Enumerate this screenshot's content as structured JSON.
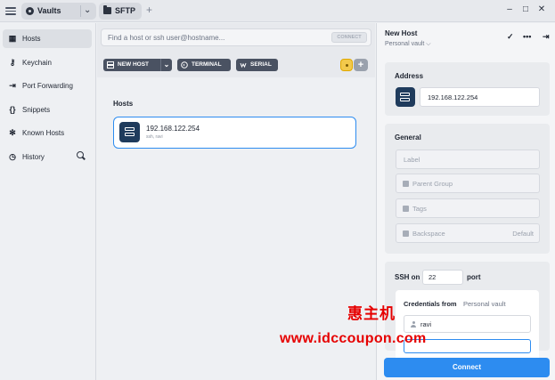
{
  "topbar": {
    "vault_label": "Vaults",
    "tab_label": "SFTP",
    "new_tab_symbol": "+",
    "window_buttons": [
      "–",
      "□",
      "✕"
    ]
  },
  "sidebar": {
    "items": [
      {
        "label": "Hosts",
        "icon": "hosts-icon",
        "active": true
      },
      {
        "label": "Keychain",
        "icon": "key-icon"
      },
      {
        "label": "Port Forwarding",
        "icon": "port-forwarding-icon"
      },
      {
        "label": "Snippets",
        "icon": "snippets-icon"
      },
      {
        "label": "Known Hosts",
        "icon": "known-hosts-icon"
      },
      {
        "label": "History",
        "icon": "history-icon"
      }
    ]
  },
  "main": {
    "quick_connect_placeholder": "Find a host or ssh user@hostname...",
    "connect_label": "CONNECT",
    "new_host_label": "NEW HOST",
    "terminal_label": "TERMINAL",
    "serial_label": "SERIAL",
    "section_title": "Hosts",
    "hosts": [
      {
        "name": "192.168.122.254",
        "sub": "ssh, ravi"
      }
    ]
  },
  "panel": {
    "title": "New Host",
    "subtitle": "Personal vault ⌵",
    "address_title": "Address",
    "address_value": "192.168.122.254",
    "general_title": "General",
    "label_placeholder": "Label",
    "parent_group_placeholder": "Parent Group",
    "tags_placeholder": "Tags",
    "backspace_label": "Backspace",
    "backspace_value": "Default",
    "ssh_on_label": "SSH on",
    "port_value": "22",
    "port_label": "port",
    "credentials_label": "Credentials from",
    "credentials_value": "Personal vault",
    "username_value": "ravi",
    "connect_button": "Connect"
  },
  "watermark": {
    "line1": "惠主机",
    "line2": "www.idccoupon.com"
  },
  "colors": {
    "accent": "#2d8cf0",
    "host_icon": "#1f3b5c",
    "watermark": "#e60000"
  }
}
